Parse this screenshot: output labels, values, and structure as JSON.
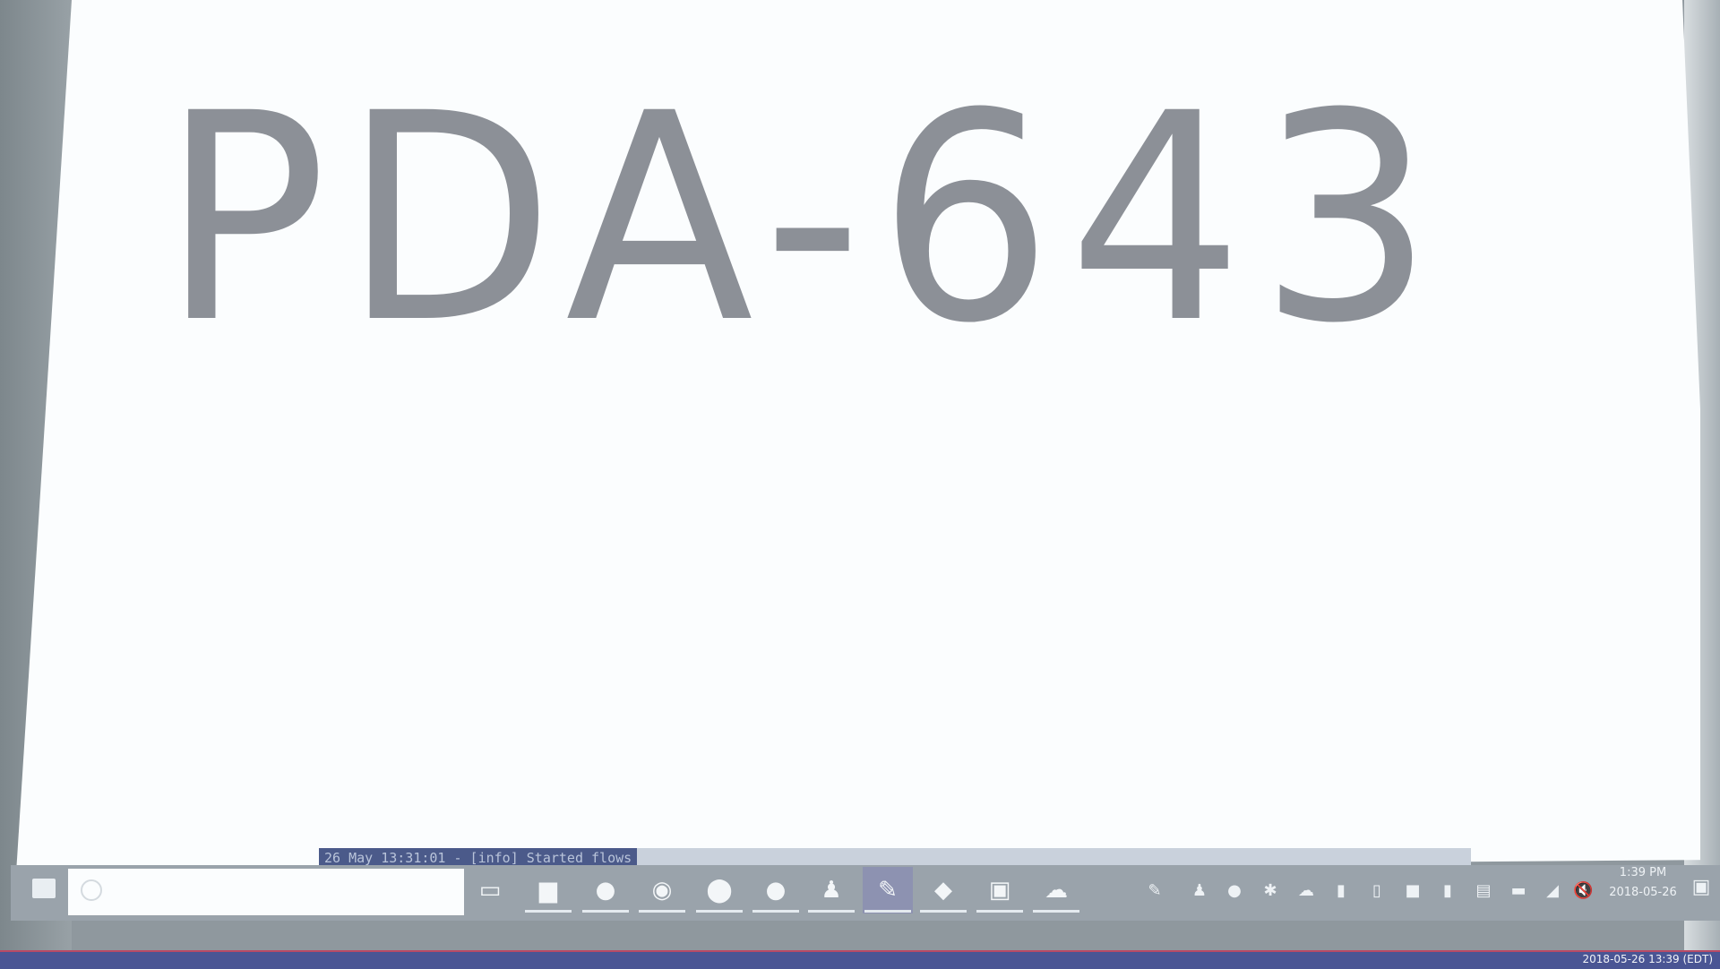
{
  "screen": {
    "headline": "PDA-643"
  },
  "console": {
    "log_line": "26 May 13:31:01 - [info] Started flows"
  },
  "taskbar": {
    "start_icon": "windows-start-icon",
    "search_placeholder": "",
    "apps": [
      {
        "name": "task-view-icon",
        "glyph": "▭"
      },
      {
        "name": "file-explorer-icon",
        "glyph": "▆"
      },
      {
        "name": "app-icon-2",
        "glyph": "●"
      },
      {
        "name": "app-icon-3",
        "glyph": "◉"
      },
      {
        "name": "app-icon-4",
        "glyph": "⬤"
      },
      {
        "name": "app-icon-5",
        "glyph": "●"
      },
      {
        "name": "app-icon-6",
        "glyph": "♟"
      },
      {
        "name": "app-icon-7",
        "glyph": "✎"
      },
      {
        "name": "app-icon-8",
        "glyph": "◆"
      },
      {
        "name": "app-icon-9",
        "glyph": "▣"
      },
      {
        "name": "app-icon-10",
        "glyph": "☁"
      }
    ],
    "tray": [
      {
        "name": "tray-icon-1",
        "glyph": "✎"
      },
      {
        "name": "tray-icon-2",
        "glyph": "♟"
      },
      {
        "name": "tray-icon-3",
        "glyph": "●"
      },
      {
        "name": "tray-icon-4",
        "glyph": "✱"
      },
      {
        "name": "tray-icon-5",
        "glyph": "☁"
      },
      {
        "name": "tray-icon-6",
        "glyph": "▮"
      },
      {
        "name": "tray-icon-7",
        "glyph": "▯"
      },
      {
        "name": "tray-icon-8",
        "glyph": "■"
      },
      {
        "name": "tray-icon-9",
        "glyph": "▮"
      },
      {
        "name": "tray-icon-10",
        "glyph": "▤"
      },
      {
        "name": "tray-icon-11",
        "glyph": "▬"
      },
      {
        "name": "wifi-icon",
        "glyph": "◢"
      },
      {
        "name": "volume-muted-icon",
        "glyph": "🔇"
      }
    ],
    "clock": {
      "time": "1:39 PM",
      "date": "2018-05-26"
    },
    "notification_icon": "action-center-icon"
  },
  "overlay": {
    "timestamp": "2018-05-26 13:39 (EDT)"
  },
  "colors": {
    "screen_bg": "#fbfdfe",
    "headline": "#8c9097",
    "taskbar": "#9aa3ab",
    "overlay": "#4a5594"
  }
}
